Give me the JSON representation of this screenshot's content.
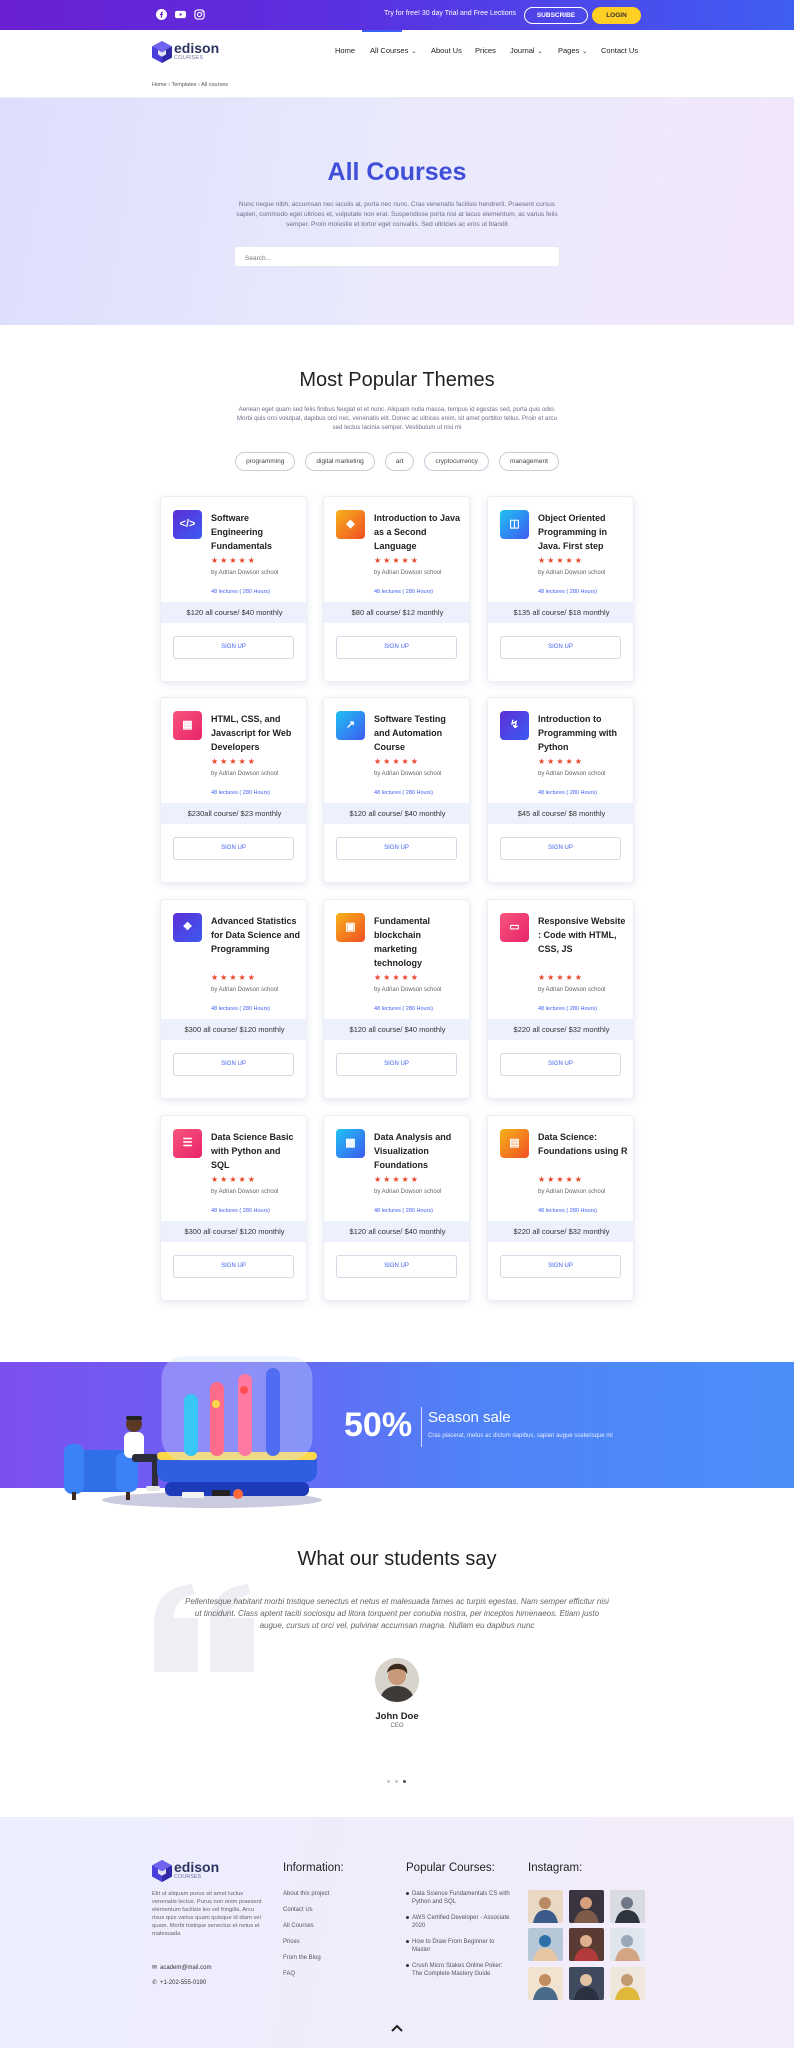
{
  "topbar": {
    "social_icons": [
      "facebook-icon",
      "youtube-icon",
      "instagram-icon"
    ],
    "promo": "Try for free! 30 day Trial and Free Lections",
    "subscribe_label": "SUBSCRIBE",
    "login_label": "LOGIN"
  },
  "header": {
    "logo_name": "edison",
    "logo_tag": "COURSES",
    "nav": [
      {
        "label": "Home",
        "dropdown": false
      },
      {
        "label": "All Courses",
        "dropdown": true
      },
      {
        "label": "About Us",
        "dropdown": false
      },
      {
        "label": "Prices",
        "dropdown": false
      },
      {
        "label": "Journal",
        "dropdown": true
      },
      {
        "label": "Pages",
        "dropdown": true
      },
      {
        "label": "Contact Us",
        "dropdown": false
      }
    ],
    "breadcrumb": "Home › Templates › All courses"
  },
  "hero": {
    "title": "All Courses",
    "text": "Nunc neque nibh, accumsan nec iaculis at, porta nec nunc. Cras venenatis facilisis hendrerit. Praesent cursus sapien, commodo eget ultrices et, vulputate non erat. Suspendisse porta nisl at lacus elementum, ac varius felis semper. Proin molestie et tortor eget convallis. Sed ultricies ac eros ut blandit",
    "search_placeholder": "Search..."
  },
  "themes": {
    "title": "Most Popular Themes",
    "text": "Aenean eget quam sed felis finibus feugiat et et nunc. Aliquam nulla massa, tempus id egestas sed, porta quis odio. Morbi quis orci volutpat, dapibus orci nec, venenatis elit. Donec ac ultrices enim, sit amet porttitor tellus. Proin et arcu sed lectus lacinia semper. Vestibulum ut nisi mi",
    "tags": [
      "programming",
      "digital marketing",
      "art",
      "cryptocurrency",
      "management"
    ]
  },
  "courses": [
    {
      "title": "Software Engineering Fundamentals",
      "rating": 5,
      "author": "by Adrian Dowson school",
      "lectures": "48 lectures ( 280 Hours)",
      "price": "$120 all course/ $40 monthly",
      "signup": "SIGN UP",
      "icon": "code-icon",
      "color1": "#5b2fd6",
      "color2": "#3d5af1"
    },
    {
      "title": "Introduction to Java as a Second Language",
      "rating": 5,
      "author": "by Adrian Dowson school",
      "lectures": "48 lectures ( 280 Hours)",
      "price": "$80 all course/ $12 monthly",
      "signup": "SIGN UP",
      "icon": "network-icon",
      "color1": "#f7b21b",
      "color2": "#f04e23"
    },
    {
      "title": "Object Oriented Programming in Java. First step",
      "rating": 5,
      "author": "by Adrian Dowson school",
      "lectures": "48 lectures ( 280 Hours)",
      "price": "$135 all course/ $18 monthly",
      "signup": "SIGN UP",
      "icon": "windows-icon",
      "color1": "#1fc2f2",
      "color2": "#3d5af1"
    },
    {
      "title": "HTML, CSS, and Javascript for Web Developers",
      "rating": 5,
      "author": "by Adrian Dowson school",
      "lectures": "48 lectures ( 280 Hours)",
      "price": "$230all course/ $23 monthly",
      "signup": "SIGN UP",
      "icon": "layout-icon",
      "color1": "#f7567c",
      "color2": "#e8236a"
    },
    {
      "title": "Software Testing and Automation Course",
      "rating": 5,
      "author": "by Adrian Dowson school",
      "lectures": "48 lectures ( 280 Hours)",
      "price": "$120 all course/ $40 monthly",
      "signup": "SIGN UP",
      "icon": "chart-line-icon",
      "color1": "#1fc2f2",
      "color2": "#3d5af1"
    },
    {
      "title": "Introduction to Programming with Python",
      "rating": 5,
      "author": "by Adrian Dowson school",
      "lectures": "48 lectures ( 280 Hours)",
      "price": "$45 all course/ $8 monthly",
      "signup": "SIGN UP",
      "icon": "branch-icon",
      "color1": "#5b2fd6",
      "color2": "#3d5af1"
    },
    {
      "title": "Advanced Statistics for Data Science and Programming",
      "rating": 5,
      "author": "by Adrian Dowson school",
      "lectures": "48 lectures ( 280 Hours)",
      "price": "$300 all course/ $120 monthly",
      "signup": "SIGN UP",
      "icon": "brain-icon",
      "color1": "#5b2fd6",
      "color2": "#3d5af1"
    },
    {
      "title": "Fundamental blockchain marketing technology",
      "rating": 5,
      "author": "by Adrian Dowson school",
      "lectures": "48 lectures ( 280 Hours)",
      "price": "$120 all course/ $40 monthly",
      "signup": "SIGN UP",
      "icon": "blocks-icon",
      "color1": "#f7b21b",
      "color2": "#f04e23"
    },
    {
      "title": "Responsive Website : Code with HTML, CSS, JS",
      "rating": 5,
      "author": "by Adrian Dowson school",
      "lectures": "48 lectures ( 280 Hours)",
      "price": "$220 all course/ $32 monthly",
      "signup": "SIGN UP",
      "icon": "monitor-icon",
      "color1": "#f7567c",
      "color2": "#e8236a"
    },
    {
      "title": "Data Science Basic with Python and SQL",
      "rating": 5,
      "author": "by Adrian Dowson school",
      "lectures": "48 lectures ( 280 Hours)",
      "price": "$300 all course/ $120 monthly",
      "signup": "SIGN UP",
      "icon": "database-icon",
      "color1": "#f7567c",
      "color2": "#e8236a"
    },
    {
      "title": "Data Analysis and Visualization Foundations",
      "rating": 5,
      "author": "by Adrian Dowson school",
      "lectures": "48 lectures ( 280 Hours)",
      "price": "$120 all course/ $40 monthly",
      "signup": "SIGN UP",
      "icon": "cubes-icon",
      "color1": "#1fc2f2",
      "color2": "#3d5af1"
    },
    {
      "title": "Data Science: Foundations using R",
      "rating": 5,
      "author": "by Adrian Dowson school",
      "lectures": "48 lectures ( 280 Hours)",
      "price": "$220 all course/ $32 monthly",
      "signup": "SIGN UP",
      "icon": "document-icon",
      "color1": "#f7b21b",
      "color2": "#f04e23"
    }
  ],
  "sale": {
    "percent": "50%",
    "title": "Season sale",
    "text": "Cras placerat, metus ac dictum dapibus, sapien augue scelerisque mi"
  },
  "testimonials": {
    "title": "What our students say",
    "quote": "Pellentesque habitant morbi tristique senectus et netus et malesuada fames ac turpis egestas. Nam semper efficitur nisi ut tincidunt. Class aptent taciti sociosqu ad litora torquent per conubia nostra, per inceptos himenaeos. Etiam justo augue, cursus ut orci vel, pulvinar accumsan magna. Nullam eu dapibus nunc",
    "name": "John Doe",
    "role": "CEO",
    "slides": 3,
    "active_slide": 3
  },
  "footer": {
    "logo_name": "edison",
    "logo_tag": "COURSES",
    "about": "Elit ut aliquam purus sit amet luctus venenatis lectus. Purus non enim praesent elementum facilisis leo vel fringilla. Arcu risus quis varius quam quisque id diam vel quam. Morbi tristique senectus et netus et malesuada",
    "email": "academ@mail.com",
    "phone": "+1-202-555-0190",
    "info_title": "Information:",
    "info_links": [
      "About this project",
      "Contact Us",
      "All Courses",
      "Prices",
      "From the Blog",
      "FAQ"
    ],
    "popular_title": "Popular Courses:",
    "popular_courses": [
      "Data Science Fundamentals CS with Python and SQL",
      "AWS Certified Developer - Associate 2020",
      "How to Draw From Beginner to Master",
      "Crush Micro Stakes Online Poker: The Complete Mastery Guide"
    ],
    "instagram_title": "Instagram:"
  },
  "colors": {
    "accent": "#3f5ef2",
    "star": "#e94527",
    "login": "#ffcf24",
    "topbar_start": "#6a1fd1"
  }
}
